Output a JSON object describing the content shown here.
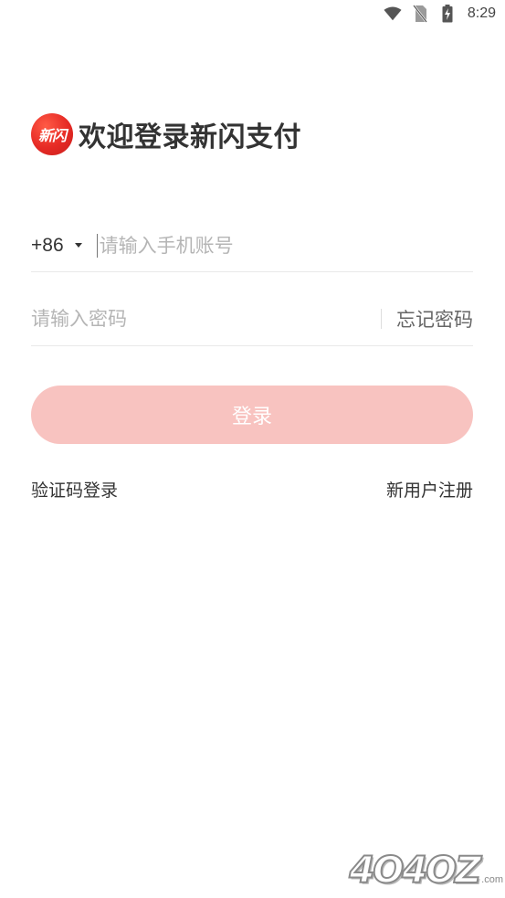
{
  "status_bar": {
    "time": "8:29",
    "icons": [
      "wifi-icon",
      "no-sim-icon",
      "battery-charging-icon"
    ]
  },
  "header": {
    "logo_text": "新闪",
    "title": "欢迎登录新闪支付"
  },
  "phone": {
    "country_code": "+86",
    "placeholder": "请输入手机账号",
    "value": ""
  },
  "password": {
    "placeholder": "请输入密码",
    "value": "",
    "forgot_label": "忘记密码"
  },
  "login_button": {
    "label": "登录"
  },
  "links": {
    "sms_login": "验证码登录",
    "register": "新用户注册"
  },
  "watermark": {
    "text": "4O4OZ",
    "suffix": ".com"
  },
  "colors": {
    "brand_red": "#e62a25",
    "login_button_disabled": "#f8c3c0"
  }
}
